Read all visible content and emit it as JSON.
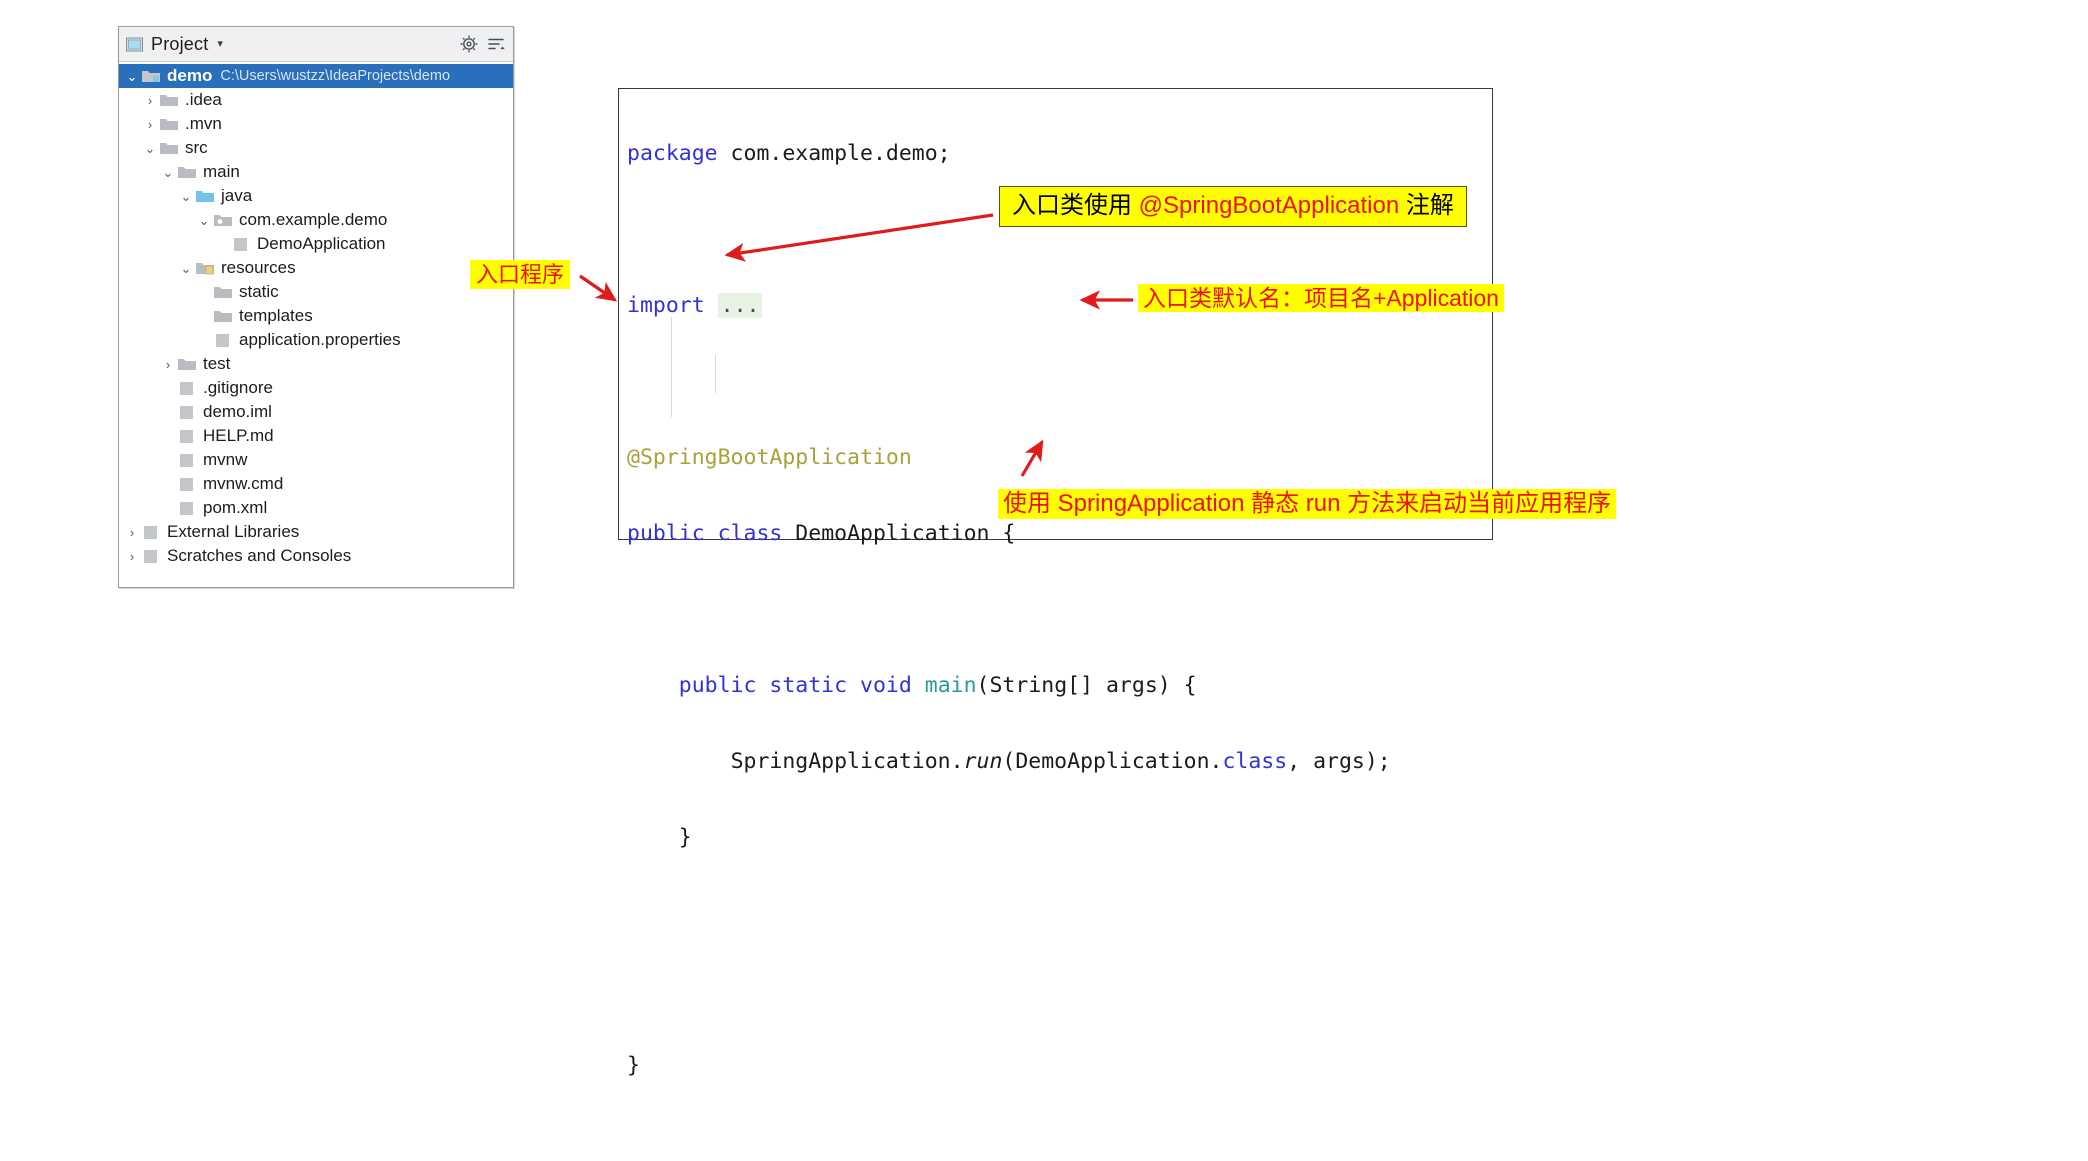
{
  "project_panel": {
    "title": "Project",
    "dropdown_caret": "▾",
    "icons": {
      "panel": "project-panel-icon",
      "settings": "settings-gear-icon",
      "collapse": "collapse-all-icon"
    },
    "tree": [
      {
        "arrow": "⌄",
        "icon": "module-folder",
        "label": "demo",
        "bold": true,
        "sub": "C:\\Users\\wustzz\\IdeaProjects\\demo",
        "indent": 0,
        "selected": true
      },
      {
        "arrow": "›",
        "icon": "folder-gray",
        "label": ".idea",
        "sub": "",
        "indent": 1,
        "selected": false
      },
      {
        "arrow": "›",
        "icon": "folder-gray",
        "label": ".mvn",
        "sub": "",
        "indent": 1,
        "selected": false
      },
      {
        "arrow": "⌄",
        "icon": "folder-gray",
        "label": "src",
        "sub": "",
        "indent": 1,
        "selected": false
      },
      {
        "arrow": "⌄",
        "icon": "folder-gray",
        "label": "main",
        "sub": "",
        "indent": 2,
        "selected": false
      },
      {
        "arrow": "⌄",
        "icon": "folder-source-blue",
        "label": "java",
        "sub": "",
        "indent": 3,
        "selected": false
      },
      {
        "arrow": "⌄",
        "icon": "package-folder",
        "label": "com.example.demo",
        "sub": "",
        "indent": 4,
        "selected": false
      },
      {
        "arrow": "",
        "icon": "java-class-run-icon",
        "label": "DemoApplication",
        "sub": "",
        "indent": 5,
        "selected": false
      },
      {
        "arrow": "⌄",
        "icon": "folder-resources",
        "label": "resources",
        "sub": "",
        "indent": 3,
        "selected": false
      },
      {
        "arrow": "",
        "icon": "folder-gray",
        "label": "static",
        "sub": "",
        "indent": 4,
        "selected": false
      },
      {
        "arrow": "",
        "icon": "folder-gray",
        "label": "templates",
        "sub": "",
        "indent": 4,
        "selected": false
      },
      {
        "arrow": "",
        "icon": "properties-file-icon",
        "label": "application.properties",
        "sub": "",
        "indent": 4,
        "selected": false
      },
      {
        "arrow": "›",
        "icon": "folder-gray",
        "label": "test",
        "sub": "",
        "indent": 2,
        "selected": false
      },
      {
        "arrow": "",
        "icon": "gitignore-file-icon",
        "label": ".gitignore",
        "sub": "",
        "indent": 2,
        "selected": false
      },
      {
        "arrow": "",
        "icon": "iml-file-icon",
        "label": "demo.iml",
        "sub": "",
        "indent": 2,
        "selected": false
      },
      {
        "arrow": "",
        "icon": "markdown-file-icon",
        "label": "HELP.md",
        "sub": "",
        "indent": 2,
        "selected": false
      },
      {
        "arrow": "",
        "icon": "shell-file-icon",
        "label": "mvnw",
        "sub": "",
        "indent": 2,
        "selected": false
      },
      {
        "arrow": "",
        "icon": "cmd-file-icon",
        "label": "mvnw.cmd",
        "sub": "",
        "indent": 2,
        "selected": false
      },
      {
        "arrow": "",
        "icon": "maven-file-icon",
        "label": "pom.xml",
        "sub": "",
        "indent": 2,
        "selected": false
      },
      {
        "arrow": "›",
        "icon": "libraries-icon",
        "label": "External Libraries",
        "sub": "",
        "indent": 0,
        "selected": false
      },
      {
        "arrow": "›",
        "icon": "scratches-icon",
        "label": "Scratches and Consoles",
        "sub": "",
        "indent": 0,
        "selected": false
      }
    ]
  },
  "editor": {
    "lines": {
      "l1_kw": "package",
      "l1_rest": " com.example.demo;",
      "l2_kw": "import",
      "l2_fold": "...",
      "l3_annotation": "@SpringBootApplication",
      "l4_kw1": "public",
      "l4_kw2": "class",
      "l4_name": " DemoApplication {",
      "l5_kw1": "public",
      "l5_kw2": "static",
      "l5_kw3": "void",
      "l5_method": "main",
      "l5_rest": "(String[] args) {",
      "l6_a": "SpringApplication.",
      "l6_run": "run",
      "l6_b": "(DemoApplication.",
      "l6_kw": "class",
      "l6_c": ", args);",
      "l7": "}",
      "l8": "}"
    }
  },
  "annotations": {
    "entry_program": "入口程序",
    "uses_annotation_cn": "入口类使用 ",
    "uses_annotation_code": "@SpringBootApplication",
    "uses_annotation_cn2": " 注解",
    "default_name": "入口类默认名：项目名+Application",
    "run_method": "使用 SpringApplication 静态 run 方法来启动当前应用程序"
  },
  "colors": {
    "highlight": "#ffff00",
    "note_red": "#ee1111",
    "note_black": "#000000",
    "arrow_red": "#e01b1b",
    "selection_blue": "#2a6fbb",
    "keyword_blue": "#3232d6",
    "annotation_gold": "#a8a13c",
    "method_teal": "#2a9b9b",
    "fold_green": "#e8f3e4"
  }
}
